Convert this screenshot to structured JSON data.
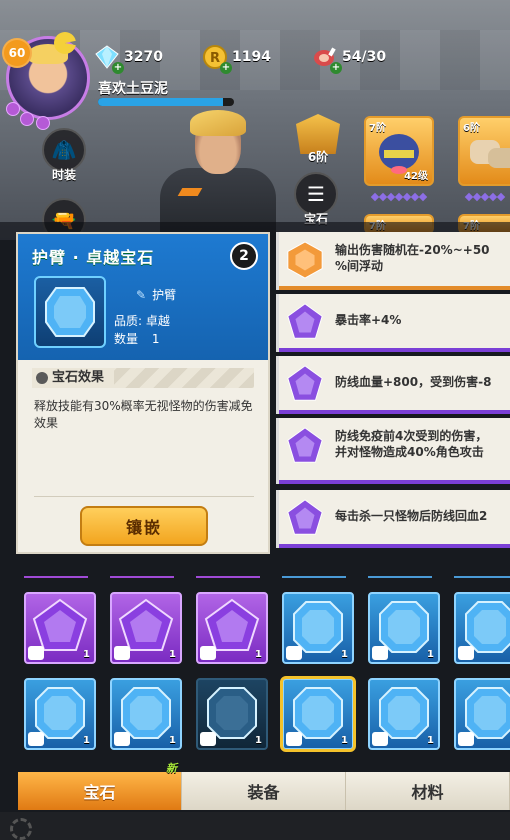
{
  "header": {
    "level": "60",
    "player_name": "喜欢土豆泥",
    "exp_fraction": 0.92,
    "resources": [
      {
        "icon": "diamond-icon",
        "value": "3270"
      },
      {
        "icon": "coin-icon",
        "value": "1194"
      },
      {
        "icon": "meat-icon",
        "value": "54/30"
      }
    ]
  },
  "side_buttons": {
    "costume_label": "时装",
    "gem_label": "宝石",
    "rank_label": "6阶"
  },
  "equip_cards": [
    {
      "tier": "7阶",
      "level": "42级"
    },
    {
      "tier": "6阶",
      "level": ""
    },
    {
      "tier": "7阶",
      "level": ""
    },
    {
      "tier": "7阶",
      "level": ""
    }
  ],
  "detail": {
    "title": "护臂 · 卓越宝石",
    "close_icon": "close-icon",
    "slot_label": "护臂",
    "quality_key": "品质:",
    "quality_value": "卓越",
    "quantity_key": "数量",
    "quantity_value": "1",
    "effect_section_title": "宝石效果",
    "effect_description": "释放技能有30%概率无视怪物的伤害减免效果",
    "embed_button": "镶嵌"
  },
  "effect_list": [
    {
      "text_line1": "输出伤害随机在-20%~+50",
      "text_line2": "%间浮动",
      "color": "orange"
    },
    {
      "text_line1": "暴击率+4%",
      "text_line2": "",
      "color": "purple"
    },
    {
      "text_line1": "防线血量+800，受到伤害-8",
      "text_line2": "",
      "color": "purple"
    },
    {
      "text_line1": "防线免疫前4次受到的伤害，",
      "text_line2": "并对怪物造成40%角色攻击",
      "color": "purple"
    },
    {
      "text_line1": "每击杀一只怪物后防线回血2",
      "text_line2": "",
      "color": "purple"
    }
  ],
  "gem_grid": [
    {
      "type": "purple",
      "count": "1"
    },
    {
      "type": "purple",
      "count": "1"
    },
    {
      "type": "purple",
      "count": "1"
    },
    {
      "type": "blue",
      "count": "1"
    },
    {
      "type": "blue",
      "count": "1"
    },
    {
      "type": "blue",
      "count": "1"
    },
    {
      "type": "blue",
      "count": "1"
    },
    {
      "type": "blue",
      "count": "1"
    },
    {
      "type": "dark",
      "count": "1"
    },
    {
      "type": "blue",
      "count": "1",
      "selected": true
    },
    {
      "type": "blue",
      "count": "1"
    },
    {
      "type": "blue",
      "count": "1"
    }
  ],
  "tabs": [
    {
      "label": "宝石",
      "active": true
    },
    {
      "label": "装备",
      "active": false
    },
    {
      "label": "材料",
      "active": false
    }
  ],
  "new_badge": "新"
}
